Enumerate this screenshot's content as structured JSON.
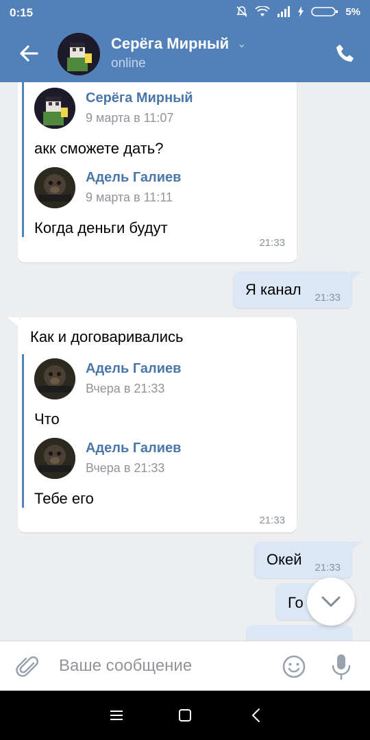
{
  "status_bar": {
    "time": "0:15",
    "battery": "5%"
  },
  "header": {
    "contact_name": "Серёга Мирный",
    "contact_status": "online"
  },
  "messages": [
    {
      "direction": "in",
      "forwarded": [
        {
          "author": "Серёга Мирный",
          "date": "9 марта в 11:07",
          "text": "акк сможете дать?"
        },
        {
          "author": "Адель Галиев",
          "date": "9 марта в 11:11",
          "text": "Когда деньги будут"
        }
      ],
      "time": "21:33"
    },
    {
      "direction": "out",
      "text": "Я канал",
      "time": "21:33"
    },
    {
      "direction": "in",
      "text": "Как и договаривались",
      "forwarded": [
        {
          "author": "Адель Галиев",
          "date": "Вчера в 21:33",
          "text": "Что"
        },
        {
          "author": "Адель Галиев",
          "date": "Вчера в 21:33",
          "text": "Тебе его"
        }
      ],
      "time": "21:33"
    },
    {
      "direction": "out",
      "text": "Окей",
      "time": "21:33"
    },
    {
      "direction": "out",
      "text": "Го"
    }
  ],
  "composer": {
    "placeholder": "Ваше сообщение"
  },
  "colors": {
    "header": "#5181b8",
    "chat_background": "#edeef0",
    "outgoing_bubble": "#dbe7f4",
    "link_name": "#4a76a8"
  }
}
